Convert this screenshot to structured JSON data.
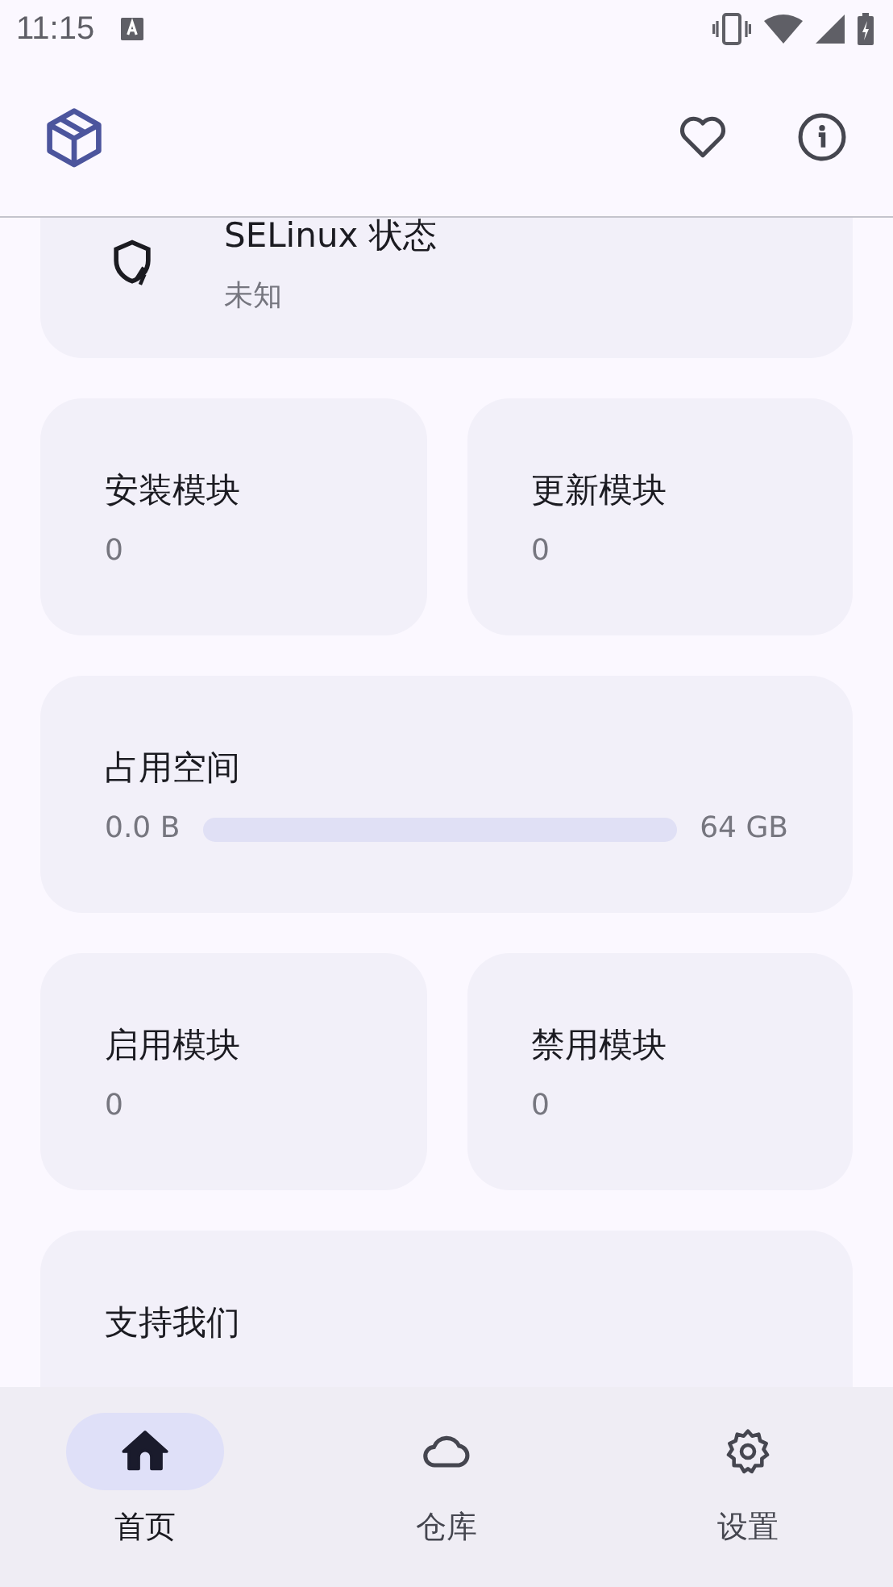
{
  "status_bar": {
    "time": "11:15"
  },
  "selinux": {
    "title": "SELinux 状态",
    "value": "未知"
  },
  "stats_top": [
    {
      "label": "安装模块",
      "value": "0"
    },
    {
      "label": "更新模块",
      "value": "0"
    }
  ],
  "storage": {
    "title": "占用空间",
    "used": "0.0 B",
    "total": "64 GB",
    "level": 0
  },
  "stats_bottom": [
    {
      "label": "启用模块",
      "value": "0"
    },
    {
      "label": "禁用模块",
      "value": "0"
    }
  ],
  "support": {
    "title": "支持我们"
  },
  "nav": [
    {
      "kind": "home",
      "label": "首页",
      "selected": true
    },
    {
      "kind": "cloud",
      "label": "仓库",
      "selected": false
    },
    {
      "kind": "settings",
      "label": "设置",
      "selected": false
    }
  ]
}
